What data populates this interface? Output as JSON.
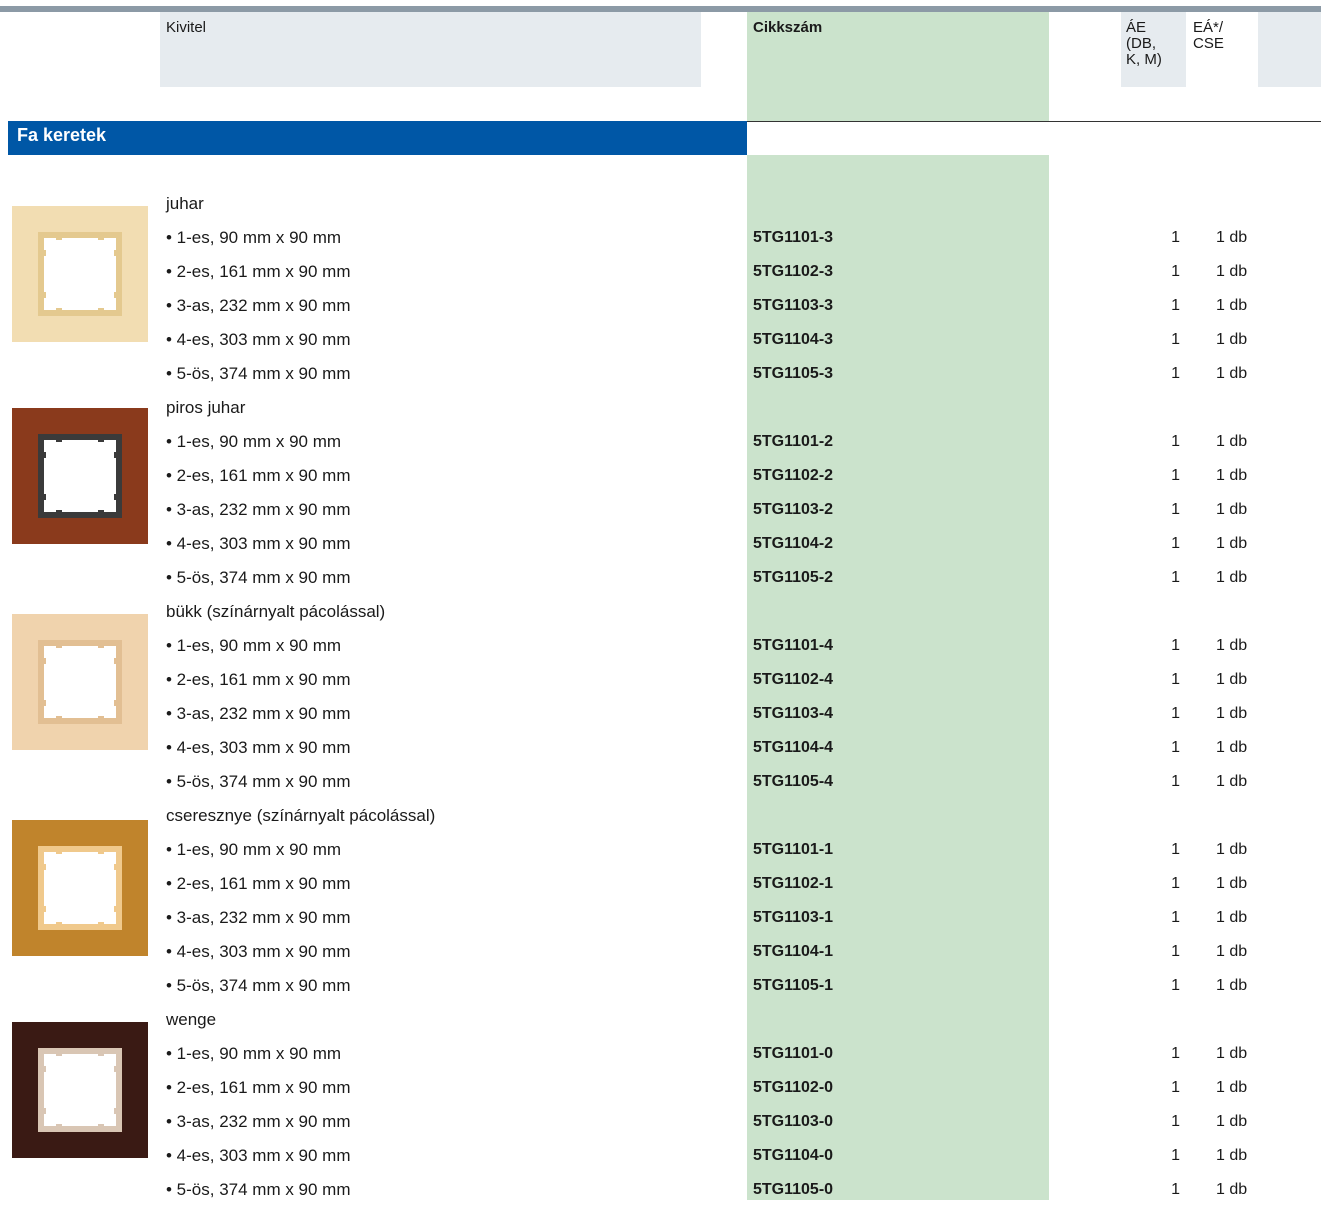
{
  "header": {
    "kivitel": "Kivitel",
    "cikkszam": "Cikkszám",
    "ae_lines": [
      "ÁE",
      "(DB,",
      "K, M)"
    ],
    "ea_lines": [
      "EÁ*/",
      "CSE"
    ]
  },
  "section": {
    "title": "Fa keretek"
  },
  "groups": [
    {
      "name": "juhar",
      "swatch": {
        "icon": "maple-frame-icon",
        "frame_color": "#f2ddb2",
        "window_color": "#ffffff",
        "edge_color": "#e4c98f"
      },
      "items": [
        {
          "desc": "• 1-es, 90 mm x 90 mm",
          "code": "5TG1101-3",
          "ae": "1",
          "ea": "1 db"
        },
        {
          "desc": "• 2-es, 161 mm x 90 mm",
          "code": "5TG1102-3",
          "ae": "1",
          "ea": "1 db"
        },
        {
          "desc": "• 3-as, 232 mm x 90 mm",
          "code": "5TG1103-3",
          "ae": "1",
          "ea": "1 db"
        },
        {
          "desc": "• 4-es, 303 mm x 90 mm",
          "code": "5TG1104-3",
          "ae": "1",
          "ea": "1 db"
        },
        {
          "desc": "• 5-ös, 374 mm x 90 mm",
          "code": "5TG1105-3",
          "ae": "1",
          "ea": "1 db"
        }
      ]
    },
    {
      "name": "piros juhar",
      "swatch": {
        "icon": "red-maple-frame-icon",
        "frame_color": "#8a3a1c",
        "window_color": "#ffffff",
        "edge_color": "#3a3a3a"
      },
      "items": [
        {
          "desc": "• 1-es, 90 mm x 90 mm",
          "code": "5TG1101-2",
          "ae": "1",
          "ea": "1 db"
        },
        {
          "desc": "• 2-es, 161 mm x 90 mm",
          "code": "5TG1102-2",
          "ae": "1",
          "ea": "1 db"
        },
        {
          "desc": "• 3-as, 232 mm x 90 mm",
          "code": "5TG1103-2",
          "ae": "1",
          "ea": "1 db"
        },
        {
          "desc": "• 4-es, 303 mm x 90 mm",
          "code": "5TG1104-2",
          "ae": "1",
          "ea": "1 db"
        },
        {
          "desc": "• 5-ös, 374 mm x 90 mm",
          "code": "5TG1105-2",
          "ae": "1",
          "ea": "1 db"
        }
      ]
    },
    {
      "name": "bükk (színárnyalt pácolással)",
      "swatch": {
        "icon": "beech-frame-icon",
        "frame_color": "#f0d3ad",
        "window_color": "#ffffff",
        "edge_color": "#e2bf93"
      },
      "items": [
        {
          "desc": "• 1-es, 90 mm x 90 mm",
          "code": "5TG1101-4",
          "ae": "1",
          "ea": "1 db"
        },
        {
          "desc": "• 2-es, 161 mm x 90 mm",
          "code": "5TG1102-4",
          "ae": "1",
          "ea": "1 db"
        },
        {
          "desc": "• 3-as, 232 mm x 90 mm",
          "code": "5TG1103-4",
          "ae": "1",
          "ea": "1 db"
        },
        {
          "desc": "• 4-es, 303 mm x 90 mm",
          "code": "5TG1104-4",
          "ae": "1",
          "ea": "1 db"
        },
        {
          "desc": "• 5-ös, 374 mm x 90 mm",
          "code": "5TG1105-4",
          "ae": "1",
          "ea": "1 db"
        }
      ]
    },
    {
      "name": "cseresznye (színárnyalt pácolással)",
      "swatch": {
        "icon": "cherry-frame-icon",
        "frame_color": "#c0842c",
        "window_color": "#ffffff",
        "edge_color": "#f0c98c"
      },
      "items": [
        {
          "desc": "• 1-es, 90 mm x 90 mm",
          "code": "5TG1101-1",
          "ae": "1",
          "ea": "1 db"
        },
        {
          "desc": "• 2-es, 161 mm x 90 mm",
          "code": "5TG1102-1",
          "ae": "1",
          "ea": "1 db"
        },
        {
          "desc": "• 3-as, 232 mm x 90 mm",
          "code": "5TG1103-1",
          "ae": "1",
          "ea": "1 db"
        },
        {
          "desc": "• 4-es, 303 mm x 90 mm",
          "code": "5TG1104-1",
          "ae": "1",
          "ea": "1 db"
        },
        {
          "desc": "• 5-ös, 374 mm x 90 mm",
          "code": "5TG1105-1",
          "ae": "1",
          "ea": "1 db"
        }
      ]
    },
    {
      "name": "wenge",
      "swatch": {
        "icon": "wenge-frame-icon",
        "frame_color": "#3a1a14",
        "window_color": "#ffffff",
        "edge_color": "#d9c6b4"
      },
      "items": [
        {
          "desc": "• 1-es, 90 mm x 90 mm",
          "code": "5TG1101-0",
          "ae": "1",
          "ea": "1 db"
        },
        {
          "desc": "• 2-es, 161 mm x 90 mm",
          "code": "5TG1102-0",
          "ae": "1",
          "ea": "1 db"
        },
        {
          "desc": "• 3-as, 232 mm x 90 mm",
          "code": "5TG1103-0",
          "ae": "1",
          "ea": "1 db"
        },
        {
          "desc": "• 4-es, 303 mm x 90 mm",
          "code": "5TG1104-0",
          "ae": "1",
          "ea": "1 db"
        },
        {
          "desc": "• 5-ös, 374 mm x 90 mm",
          "code": "5TG1105-0",
          "ae": "1",
          "ea": "1 db"
        }
      ]
    }
  ],
  "colors": {
    "section_blue": "#0057a6",
    "green_column": "#cbe3cc",
    "header_grey": "#e6ebef",
    "top_bar": "#8c9aa6"
  }
}
